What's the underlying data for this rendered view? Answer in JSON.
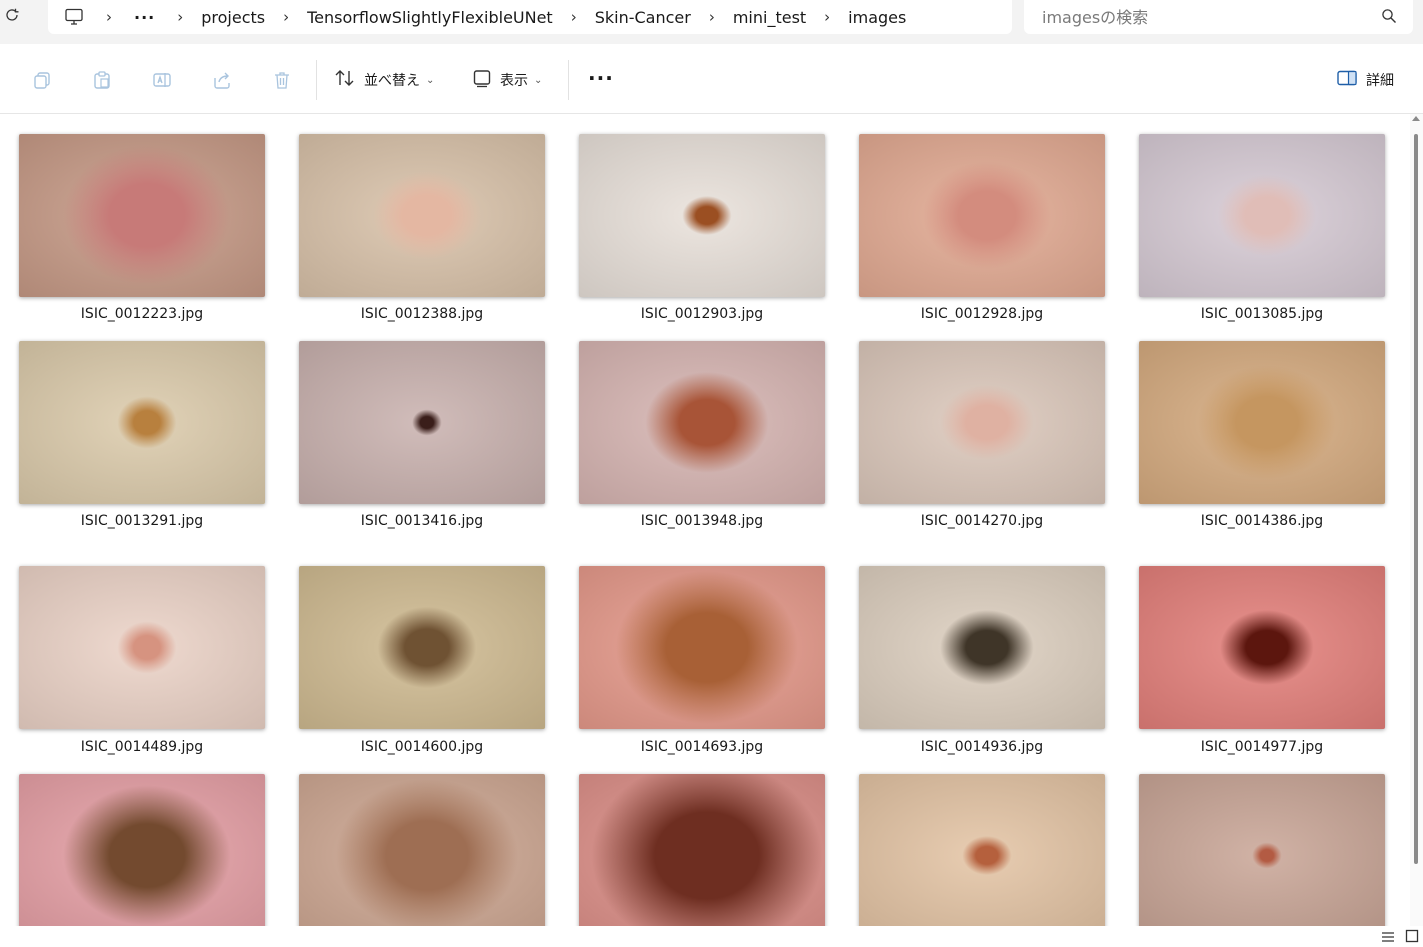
{
  "address_bar": {
    "breadcrumbs": [
      "projects",
      "TensorflowSlightlyFlexibleUNet",
      "Skin-Cancer",
      "mini_test",
      "images"
    ],
    "overflow_label": "···",
    "separator": "›"
  },
  "search": {
    "placeholder": "imagesの検索"
  },
  "toolbar": {
    "sort_label": "並べ替え",
    "view_label": "表示",
    "more_label": "···",
    "details_label": "詳細"
  },
  "files": [
    {
      "name": "ISIC_0012223.jpg",
      "bg": "#c79a86",
      "spot": "#c77a78",
      "spot_size": 0.55
    },
    {
      "name": "ISIC_0012388.jpg",
      "bg": "#d9c2a9",
      "spot": "#e4b7a2",
      "spot_size": 0.35
    },
    {
      "name": "ISIC_0012903.jpg",
      "bg": "#e9e1da",
      "spot": "#9b4f22",
      "spot_size": 0.16
    },
    {
      "name": "ISIC_0012928.jpg",
      "bg": "#e3aa92",
      "spot": "#d38c7e",
      "spot_size": 0.42
    },
    {
      "name": "ISIC_0013085.jpg",
      "bg": "#d7cbd5",
      "spot": "#e0bdb7",
      "spot_size": 0.32
    },
    {
      "name": "ISIC_0013291.jpg",
      "bg": "#dccbab",
      "spot": "#b8803e",
      "spot_size": 0.2
    },
    {
      "name": "ISIC_0013416.jpg",
      "bg": "#c9b1ae",
      "spot": "#3a1e1a",
      "spot_size": 0.1
    },
    {
      "name": "ISIC_0013948.jpg",
      "bg": "#d7b5b2",
      "spot": "#a85437",
      "spot_size": 0.4
    },
    {
      "name": "ISIC_0014270.jpg",
      "bg": "#dcc8bb",
      "spot": "#dfb1a2",
      "spot_size": 0.3
    },
    {
      "name": "ISIC_0014386.jpg",
      "bg": "#d6ab7f",
      "spot": "#c59660",
      "spot_size": 0.45
    },
    {
      "name": "ISIC_0014489.jpg",
      "bg": "#ecd3c7",
      "spot": "#d69380",
      "spot_size": 0.2
    },
    {
      "name": "ISIC_0014600.jpg",
      "bg": "#d0bb91",
      "spot": "#6f5233",
      "spot_size": 0.32
    },
    {
      "name": "ISIC_0014693.jpg",
      "bg": "#e79a8b",
      "spot": "#a86036",
      "spot_size": 0.6
    },
    {
      "name": "ISIC_0014936.jpg",
      "bg": "#ddcfbf",
      "spot": "#3f3528",
      "spot_size": 0.3
    },
    {
      "name": "ISIC_0014977.jpg",
      "bg": "#e47f7a",
      "spot": "#5c160e",
      "spot_size": 0.3
    },
    {
      "name": "",
      "bg": "#e7a0a6",
      "spot": "#734a2f",
      "spot_size": 0.55
    },
    {
      "name": "",
      "bg": "#cfa893",
      "spot": "#9e6e53",
      "spot_size": 0.6
    },
    {
      "name": "",
      "bg": "#df918a",
      "spot": "#6e2e21",
      "spot_size": 0.75
    },
    {
      "name": "",
      "bg": "#e4c4a4",
      "spot": "#b5603d",
      "spot_size": 0.16
    },
    {
      "name": "",
      "bg": "#c9a596",
      "spot": "#b35b43",
      "spot_size": 0.1
    }
  ]
}
